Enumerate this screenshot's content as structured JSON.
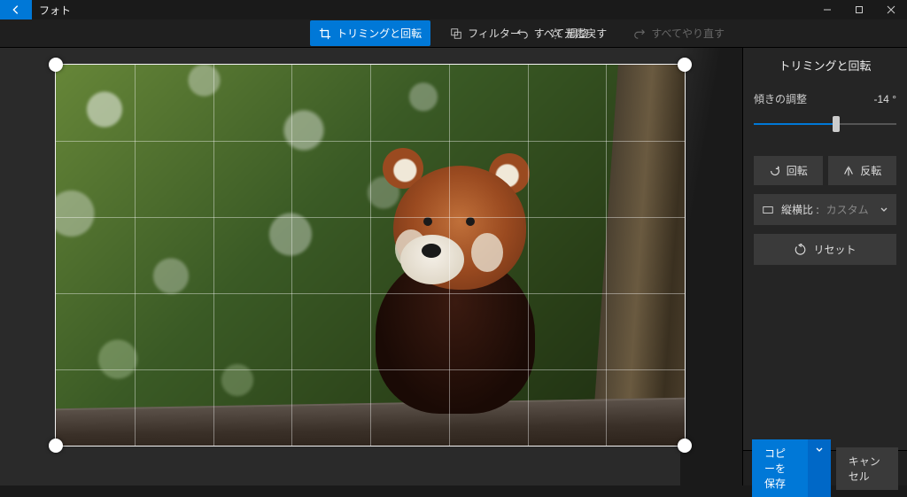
{
  "app": {
    "title": "フォト"
  },
  "toolbar": {
    "crop_rotate": "トリミングと回転",
    "filter": "フィルター",
    "adjust": "調整",
    "undo_all": "すべて元に戻す",
    "redo": "すべてやり直す"
  },
  "panel": {
    "title": "トリミングと回転",
    "tilt_label": "傾きの調整",
    "tilt_value": "-14 °",
    "tilt_percent": 58,
    "rotate": "回転",
    "flip": "反転",
    "aspect_label": "縦横比 :",
    "aspect_value": "カスタム",
    "reset": "リセット"
  },
  "footer": {
    "save": "コピーを保存",
    "cancel": "キャンセル"
  }
}
